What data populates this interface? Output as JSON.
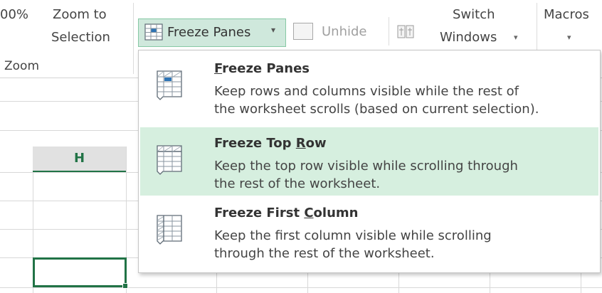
{
  "ribbon": {
    "zoom_percent_label": "00%",
    "zoom_to_selection_line1": "Zoom to",
    "zoom_to_selection_line2": "Selection",
    "zoom_group_label": "Zoom",
    "freeze_panes_label": "Freeze Panes",
    "freeze_panes_caret": "▾",
    "unhide_label": "Unhide",
    "switch_windows_line1": "Switch",
    "switch_windows_line2": "Windows",
    "switch_windows_caret": "▾",
    "macros_label": "Macros",
    "macros_caret": "▾",
    "icons": {
      "freeze_panes": "freeze-panes-icon",
      "unhide": "unhide-icon",
      "view_side_by_side": "view-side-by-side-icon"
    }
  },
  "sheet": {
    "column_header": "H",
    "selected_cell": "H (active cell)"
  },
  "dropdown": {
    "items": [
      {
        "title_pre": "",
        "title_key": "F",
        "title_post": "reeze Panes",
        "desc_line1": "Keep rows and columns visible while the rest of",
        "desc_line2": "the worksheet scrolls (based on current selection).",
        "icon": "freeze-panes-grid-icon",
        "highlighted": false
      },
      {
        "title_pre": "Freeze Top ",
        "title_key": "R",
        "title_post": "ow",
        "desc_line1": "Keep the top row visible while scrolling through",
        "desc_line2": "the rest of the worksheet.",
        "icon": "freeze-top-row-icon",
        "highlighted": true
      },
      {
        "title_pre": "Freeze First ",
        "title_key": "C",
        "title_post": "olumn",
        "desc_line1": "Keep the first column visible while scrolling",
        "desc_line2": "through the rest of the worksheet.",
        "icon": "freeze-first-column-icon",
        "highlighted": false
      }
    ]
  },
  "colors": {
    "excel_green": "#217346",
    "highlight": "#d6efdf",
    "button_active": "#cfe8dc"
  }
}
